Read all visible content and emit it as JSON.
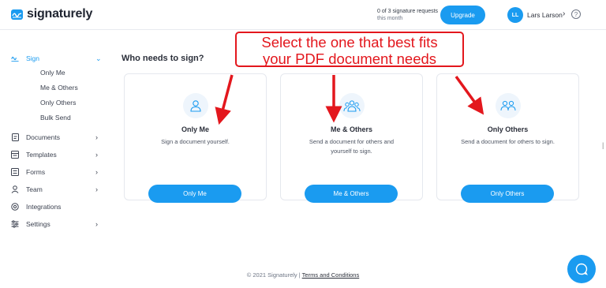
{
  "brand": {
    "name": "signaturely",
    "color": "#1a9bf0"
  },
  "header": {
    "requests_line1": "0 of 3 signature requests",
    "requests_line2": "this month",
    "upgrade_label": "Upgrade",
    "avatar_initials": "LL",
    "user_name": "Lars Larson",
    "user_chevron": "›",
    "help_icon": "?"
  },
  "sidebar": {
    "items": [
      {
        "label": "Sign",
        "icon": "signature-icon",
        "active": true,
        "chevron": "⌄",
        "subitems": [
          "Only Me",
          "Me & Others",
          "Only Others",
          "Bulk Send"
        ]
      },
      {
        "label": "Documents",
        "icon": "document-icon",
        "chevron": "›"
      },
      {
        "label": "Templates",
        "icon": "template-icon",
        "chevron": "›"
      },
      {
        "label": "Forms",
        "icon": "form-icon",
        "chevron": "›"
      },
      {
        "label": "Team",
        "icon": "user-icon",
        "chevron": "›"
      },
      {
        "label": "Integrations",
        "icon": "integrations-icon"
      },
      {
        "label": "Settings",
        "icon": "settings-icon",
        "chevron": "›"
      }
    ]
  },
  "main": {
    "heading": "Who needs to sign?",
    "cards": [
      {
        "title": "Only Me",
        "description": "Sign a document yourself.",
        "button": "Only Me",
        "icon": "single-user-icon"
      },
      {
        "title": "Me & Others",
        "description": "Send a document for others and yourself to sign.",
        "button": "Me & Others",
        "icon": "group-users-icon"
      },
      {
        "title": "Only Others",
        "description": "Send a document for others to sign.",
        "button": "Only Others",
        "icon": "two-users-icon"
      }
    ]
  },
  "annotation": {
    "line1": "Select the one that best fits",
    "line2": "your PDF document needs",
    "color": "#e3171d"
  },
  "footer": {
    "copyright": "© 2021 Signaturely |",
    "terms_link": "Terms and Conditions"
  },
  "right_edge_glyph": "|"
}
